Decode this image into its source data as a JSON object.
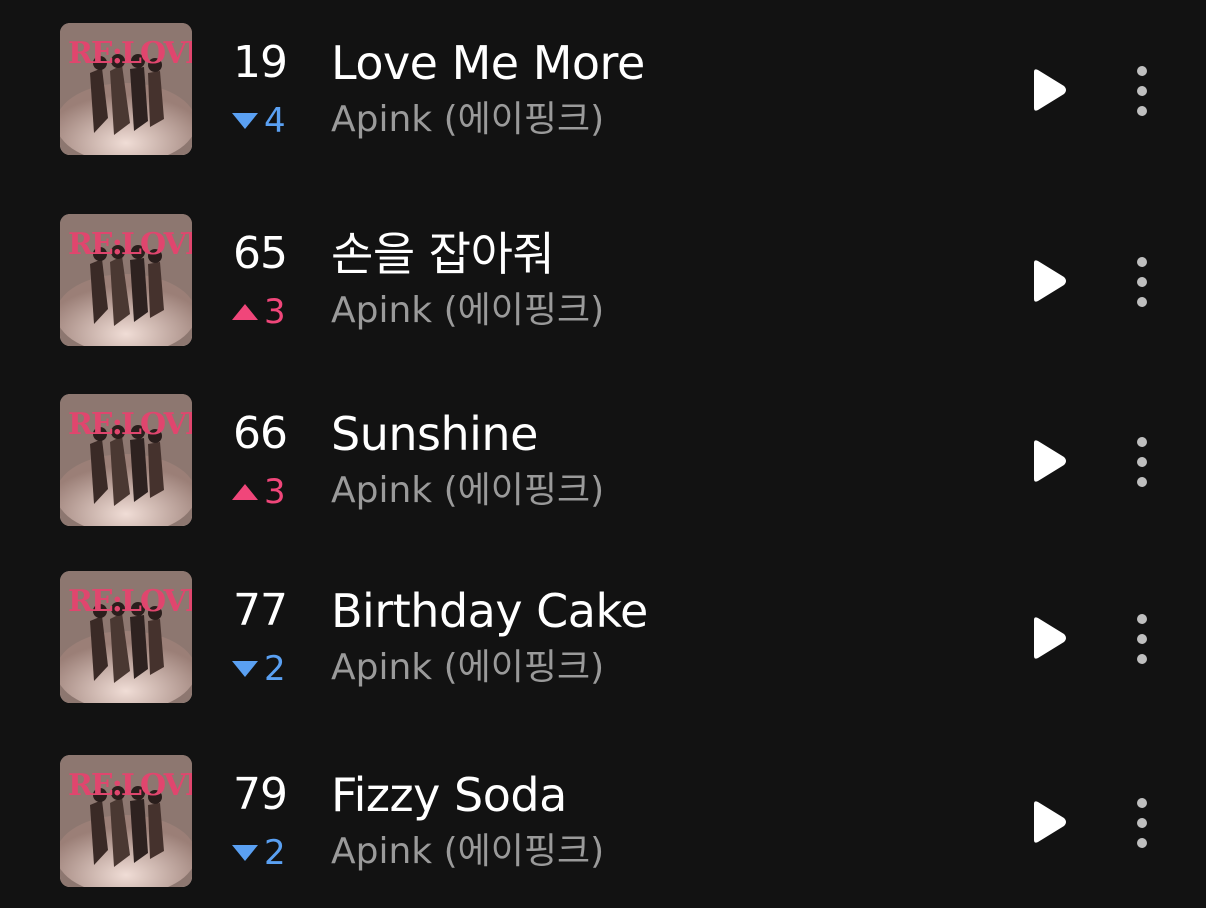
{
  "tracks": [
    {
      "rank": "19",
      "change": {
        "direction": "down",
        "amount": "4"
      },
      "title": "Love Me More",
      "artist": "Apink (에이핑크)"
    },
    {
      "rank": "65",
      "change": {
        "direction": "up",
        "amount": "3"
      },
      "title": "손을 잡아줘",
      "artist": "Apink (에이핑크)"
    },
    {
      "rank": "66",
      "change": {
        "direction": "up",
        "amount": "3"
      },
      "title": "Sunshine",
      "artist": "Apink (에이핑크)"
    },
    {
      "rank": "77",
      "change": {
        "direction": "down",
        "amount": "2"
      },
      "title": "Birthday Cake",
      "artist": "Apink (에이핑크)"
    },
    {
      "rank": "79",
      "change": {
        "direction": "down",
        "amount": "2"
      },
      "title": "Fizzy Soda",
      "artist": "Apink (에이핑크)"
    }
  ],
  "album_art": {
    "logo_text": "RE:LOVE"
  },
  "colors": {
    "background": "#121212",
    "rank_down": "#5aa0f2",
    "rank_up": "#f0467a",
    "artist_text": "#9a9a9a"
  },
  "icons": {
    "play": "play-icon",
    "more": "more-vertical-icon",
    "rank_down": "triangle-down-icon",
    "rank_up": "triangle-up-icon"
  }
}
